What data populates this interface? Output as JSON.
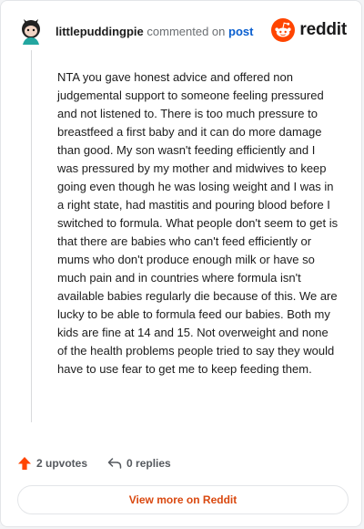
{
  "comment": {
    "username": "littlepuddingpie",
    "action_text": "commented on",
    "post_link": "post",
    "body": "NTA you gave honest advice and offered non judgemental support to someone feeling pressured and not listened to. There is too much pressure to breastfeed a first baby and it can do more damage than good. My son wasn't feeding efficiently and I was pressured by my mother and midwives to keep going even though he was losing weight and I was in a right state, had mastitis and pouring blood before I switched to formula. What people don't seem to get is that there are babies who can't feed efficiently or mums who don't produce enough milk or have so much pain and in countries where formula isn't available babies regularly die because of this. We are lucky to be able to formula feed our babies. Both my kids are fine at 14 and 15. Not overweight and none of the health problems people tried to say they would have to use fear to get me to keep feeding them.",
    "upvotes": "2 upvotes",
    "replies": "0 replies"
  },
  "brand": {
    "wordmark": "reddit",
    "icon": "reddit-snoo-logo",
    "color": "#ff4500"
  },
  "actions": {
    "view_more": "View more on Reddit"
  },
  "colors": {
    "upvote": "#ff4500",
    "link": "#0a5fcf",
    "view_more": "#d9480f"
  }
}
